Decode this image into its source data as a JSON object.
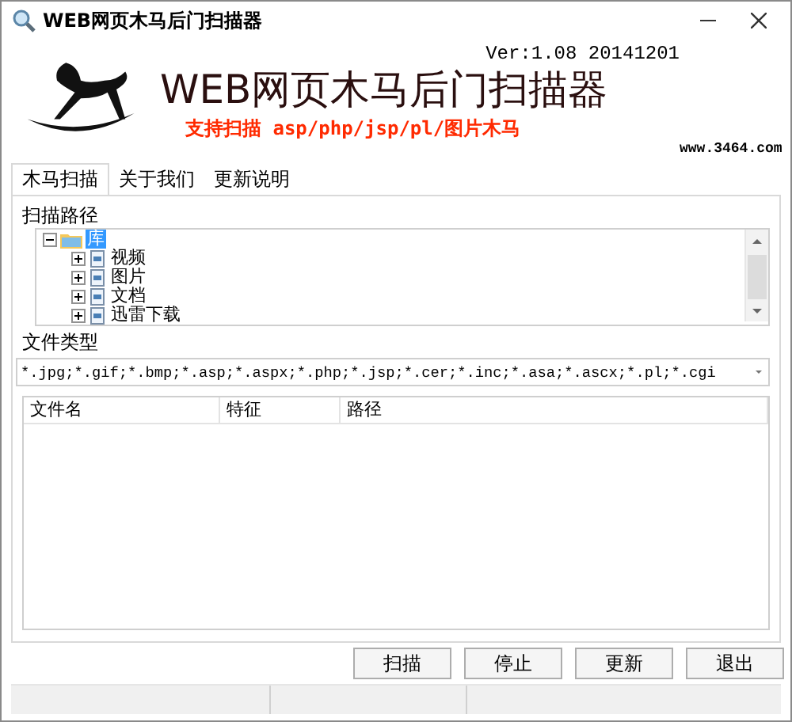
{
  "window": {
    "title": "WEB网页木马后门扫描器"
  },
  "header": {
    "version": "Ver:1.08 20141201",
    "title": "WEB网页木马后门扫描器",
    "subtitle": "支持扫描 asp/php/jsp/pl/图片木马",
    "website": "www.3464.com"
  },
  "tabs": [
    {
      "label": "木马扫描",
      "selected": true
    },
    {
      "label": "关于我们",
      "selected": false
    },
    {
      "label": "更新说明",
      "selected": false
    }
  ],
  "scan_path": {
    "label": "扫描路径",
    "tree": [
      {
        "label": "库",
        "selected": true,
        "expanded": true,
        "children": [
          {
            "label": "视频",
            "selected": false,
            "expanded": false
          },
          {
            "label": "图片",
            "selected": false,
            "expanded": false
          },
          {
            "label": "文档",
            "selected": false,
            "expanded": false
          },
          {
            "label": "迅雷下载",
            "selected": false,
            "expanded": false
          }
        ]
      }
    ]
  },
  "file_types": {
    "label": "文件类型",
    "value": "*.jpg;*.gif;*.bmp;*.asp;*.aspx;*.php;*.jsp;*.cer;*.inc;*.asa;*.ascx;*.pl;*.cgi"
  },
  "results_table": {
    "columns": [
      "文件名",
      "特征",
      "路径"
    ]
  },
  "buttons": [
    "扫描",
    "停止",
    "更新",
    "退出"
  ]
}
